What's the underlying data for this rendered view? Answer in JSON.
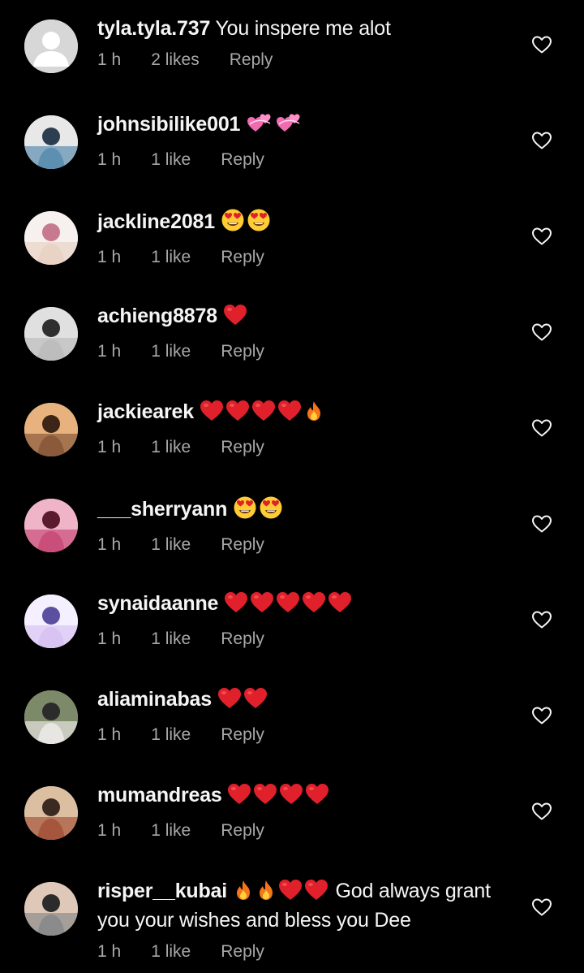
{
  "colors": {
    "background": "#000000",
    "text": "#f5f5f5",
    "meta": "#a8a8a8",
    "heart_emoji": "#e0202a",
    "fire_emoji": "#f5751a"
  },
  "meta_labels": {
    "reply": "Reply"
  },
  "comments": [
    {
      "username": "tyla.tyla.737",
      "text": "You inspere me alot",
      "time": "1 h",
      "likes": "2 likes",
      "reply": "Reply",
      "avatar": "default-avatar-icon",
      "emoji": []
    },
    {
      "username": "johnsibilike001",
      "text": "",
      "time": "1 h",
      "likes": "1 like",
      "reply": "Reply",
      "avatar": "user-photo",
      "emoji": [
        "revolving-hearts-emoji",
        "revolving-hearts-emoji"
      ]
    },
    {
      "username": "jackline2081",
      "text": "",
      "time": "1 h",
      "likes": "1 like",
      "reply": "Reply",
      "avatar": "user-photo",
      "emoji": [
        "heart-eyes-emoji",
        "heart-eyes-emoji"
      ]
    },
    {
      "username": "achieng8878",
      "text": "",
      "time": "1 h",
      "likes": "1 like",
      "reply": "Reply",
      "avatar": "user-photo",
      "emoji": [
        "red-heart-emoji"
      ]
    },
    {
      "username": "jackiearek",
      "text": "",
      "time": "1 h",
      "likes": "1 like",
      "reply": "Reply",
      "avatar": "user-photo",
      "emoji": [
        "red-heart-emoji",
        "red-heart-emoji",
        "red-heart-emoji",
        "red-heart-emoji",
        "fire-emoji"
      ]
    },
    {
      "username": "___sherryann",
      "text": "",
      "time": "1 h",
      "likes": "1 like",
      "reply": "Reply",
      "avatar": "user-photo",
      "emoji": [
        "heart-eyes-emoji",
        "heart-eyes-emoji"
      ]
    },
    {
      "username": "synaidaanne",
      "text": "",
      "time": "1 h",
      "likes": "1 like",
      "reply": "Reply",
      "avatar": "user-photo",
      "emoji": [
        "red-heart-emoji",
        "red-heart-emoji",
        "red-heart-emoji",
        "red-heart-emoji",
        "red-heart-emoji"
      ]
    },
    {
      "username": "aliaminabas",
      "text": "",
      "time": "1 h",
      "likes": "1 like",
      "reply": "Reply",
      "avatar": "user-photo",
      "emoji": [
        "red-heart-emoji",
        "red-heart-emoji"
      ]
    },
    {
      "username": "mumandreas",
      "text": "",
      "time": "1 h",
      "likes": "1 like",
      "reply": "Reply",
      "avatar": "user-photo",
      "emoji": [
        "red-heart-emoji",
        "red-heart-emoji",
        "red-heart-emoji",
        "red-heart-emoji"
      ]
    },
    {
      "username": "risper__kubai",
      "text": "God always grant you your wishes and bless you Dee",
      "time": "1 h",
      "likes": "1 like",
      "reply": "Reply",
      "avatar": "user-photo",
      "emoji": [
        "fire-emoji",
        "fire-emoji",
        "red-heart-emoji",
        "red-heart-emoji"
      ]
    }
  ]
}
